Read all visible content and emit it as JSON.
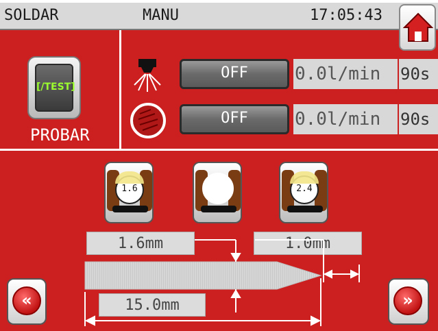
{
  "header": {
    "mode_label": "SOLDAR",
    "sub_label": "MANU",
    "time": "17:05:43"
  },
  "colors": {
    "panel_red": "#cc1f1f",
    "button_grey": "#6a6a6a",
    "test_text": "#9cff2e"
  },
  "test_button": {
    "screen_text": "[/TEST]",
    "label": "PROBAR"
  },
  "channels": [
    {
      "icon": "spray-nozzle-icon",
      "state": "OFF",
      "flow": "0.0l/min",
      "time": "90s"
    },
    {
      "icon": "coil-circle-icon",
      "state": "OFF",
      "flow": "0.0l/min",
      "time": "90s"
    }
  ],
  "tools": [
    {
      "icon": "tool-gauge-icon",
      "label": "1.6"
    },
    {
      "icon": "tool-empty-icon",
      "label": ""
    },
    {
      "icon": "tool-gauge-icon",
      "label": "2.4"
    }
  ],
  "dimensions": {
    "diameter": "1.6mm",
    "tip": "1.0mm",
    "length": "15.0mm"
  },
  "nav": {
    "prev_icon": "double-left-arrow-icon",
    "next_icon": "double-right-arrow-icon",
    "home_icon": "home-icon"
  }
}
